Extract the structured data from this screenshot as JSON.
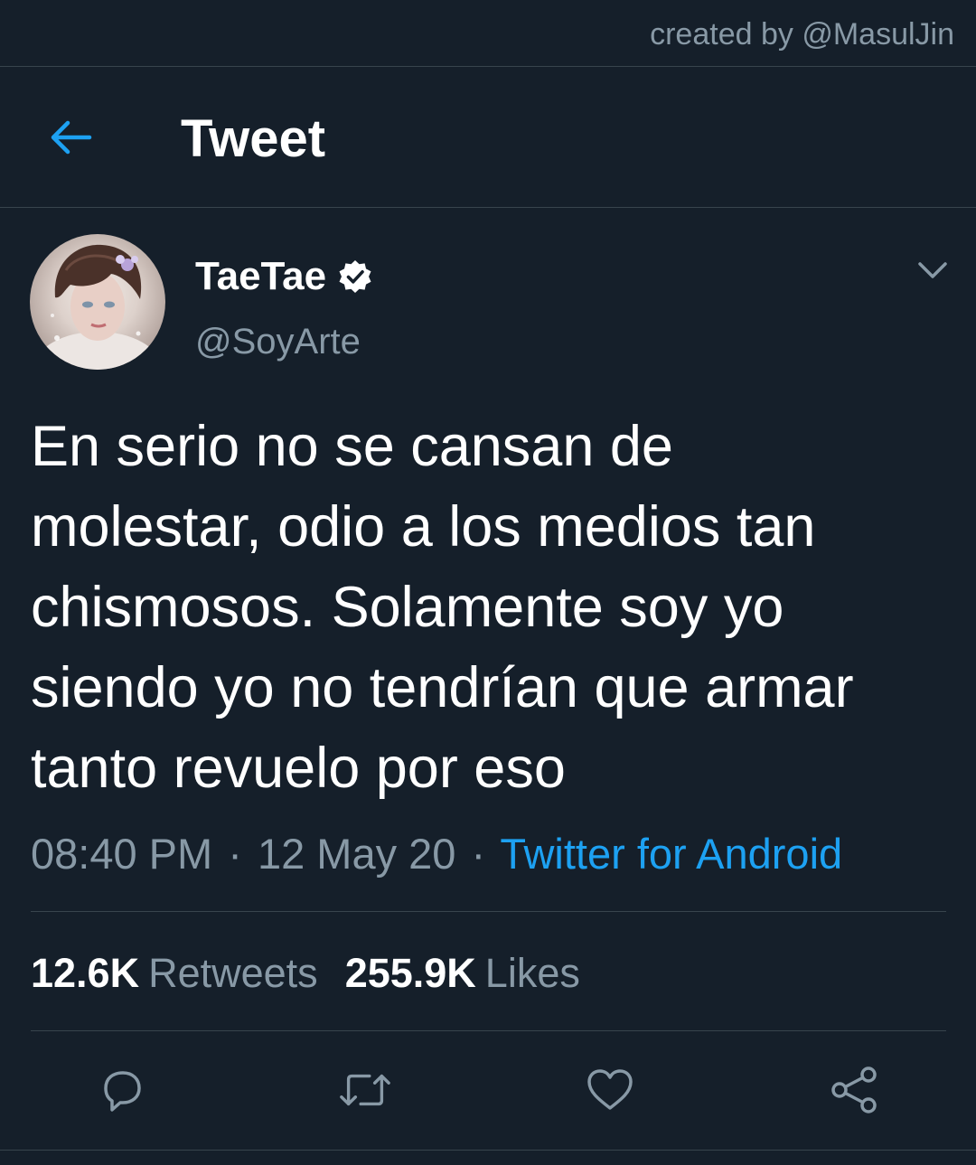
{
  "credit": "created by @MasulJin",
  "header": {
    "title": "Tweet",
    "back_icon": "arrow-left-icon"
  },
  "author": {
    "name": "TaeTae",
    "handle": "@SoyArte",
    "verified": true
  },
  "tweet": {
    "text_lines": [
      "En serio no se cansan de",
      "molestar, odio a los medios tan",
      "chismosos. Solamente soy yo",
      "siendo yo no tendrían que armar",
      "tanto revuelo por eso"
    ],
    "time": "08:40 PM",
    "date": "12 May 20",
    "client": "Twitter for Android",
    "separator": "·"
  },
  "stats": {
    "retweets_count": "12.6K",
    "retweets_label": "Retweets",
    "likes_count": "255.9K",
    "likes_label": "Likes"
  },
  "colors": {
    "background": "#151f2a",
    "accent": "#1da1f2",
    "secondary_text": "#8899a6",
    "divider": "#38444d"
  },
  "actions": [
    "reply-icon",
    "retweet-icon",
    "like-icon",
    "share-icon"
  ]
}
